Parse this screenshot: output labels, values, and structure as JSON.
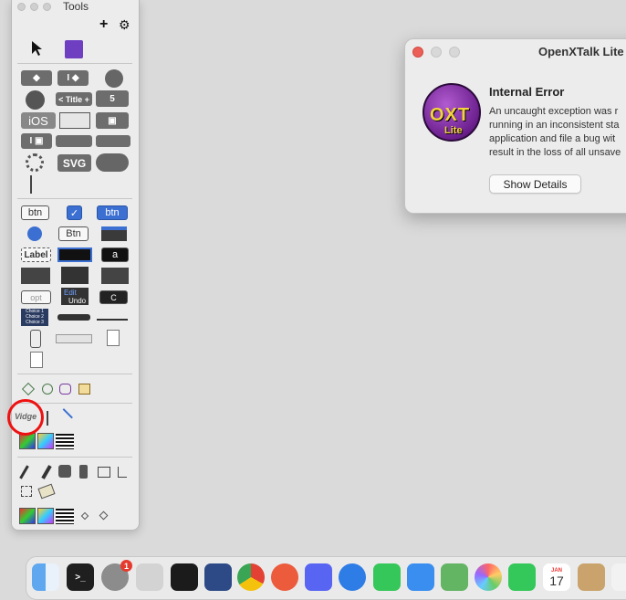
{
  "tools": {
    "title": "Tools",
    "plus": "+",
    "gear": "⚙",
    "rows": {
      "title_label": "< Title +",
      "svg_label": "SVG",
      "ios_label": "iOS",
      "btn_label": "btn",
      "Btn_label": "Btn",
      "label_label": "Label",
      "a_label": "a",
      "opt_label": "opt",
      "edit_label": "Edit",
      "undo_label": "Undo",
      "c_label": "C",
      "choice1": "Choice 1",
      "choice2": "Choice 2",
      "choice3": "Choice 3",
      "widget_label": "Vidge"
    }
  },
  "dialog": {
    "title": "OpenXTalk Lite",
    "heading": "Internal Error",
    "body": [
      "An uncaught exception was r",
      "running in an inconsistent sta",
      "application and file a bug wit",
      "result in the loss of all unsave"
    ],
    "button": "Show Details",
    "logo_text": "OXT",
    "logo_sub": "Lite"
  },
  "dock": {
    "settings_badge": "1",
    "calendar_month": "JAN",
    "calendar_day": "17"
  }
}
